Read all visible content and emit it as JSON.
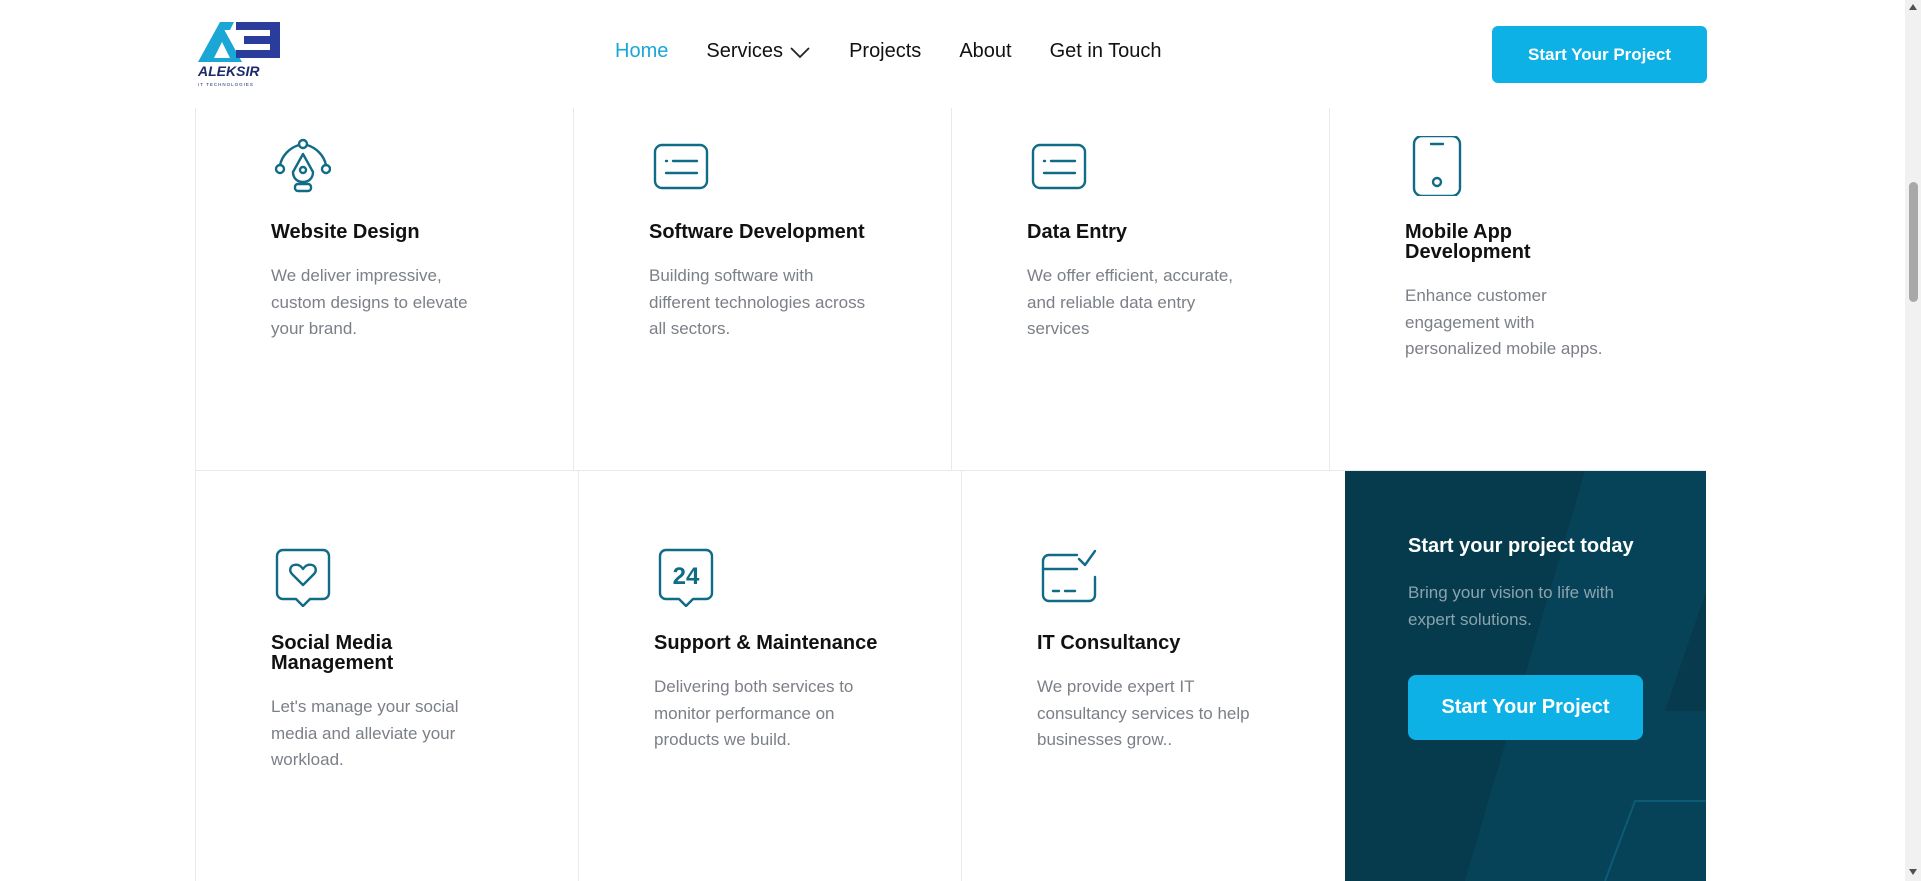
{
  "brand": {
    "logo_text": "ALEKSIR",
    "logo_tagline": "IT TECHNOLOGIES"
  },
  "nav": {
    "items": [
      {
        "label": "Home",
        "active": true
      },
      {
        "label": "Services",
        "dropdown": true
      },
      {
        "label": "Projects"
      },
      {
        "label": "About"
      },
      {
        "label": "Get in Touch"
      }
    ],
    "cta_label": "Start Your Project"
  },
  "services": [
    {
      "icon": "pen-tool-icon",
      "title": "Website Design",
      "description": "We deliver impressive, custom designs to elevate your brand."
    },
    {
      "icon": "code-window-icon",
      "title": "Software Development",
      "description": "Building  software with different technologies across all sectors."
    },
    {
      "icon": "data-window-icon",
      "title": "Data Entry",
      "description": "We offer efficient, accurate, and reliable data entry services"
    },
    {
      "icon": "smartphone-icon",
      "title": "Mobile App Development",
      "description": "Enhance customer engagement with personalized mobile apps."
    },
    {
      "icon": "heart-message-icon",
      "title": "Social Media Management",
      "description": "Let's manage your social media and alleviate your workload."
    },
    {
      "icon": "support-24-icon",
      "title": "Support & Maintenance",
      "description": "Delivering both services to monitor performance on products we build."
    },
    {
      "icon": "browser-check-icon",
      "title": "IT Consultancy",
      "description": "We provide expert IT consultancy services to help businesses grow.."
    }
  ],
  "cta_card": {
    "title": "Start your project today",
    "text": "Bring your vision to life with expert solutions.",
    "button_label": "Start Your Project"
  },
  "colors": {
    "accent": "#0db1e6",
    "icon": "#0f6b86",
    "dark_panel": "#063b4e",
    "nav_active": "#1aa7d6"
  }
}
